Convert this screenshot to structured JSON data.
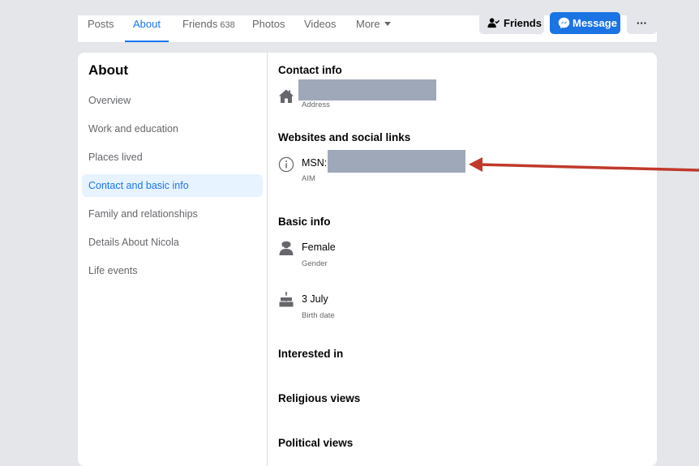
{
  "tabs": [
    {
      "label": "Posts"
    },
    {
      "label": "About"
    },
    {
      "label": "Friends",
      "count": "638"
    },
    {
      "label": "Photos"
    },
    {
      "label": "Videos"
    },
    {
      "label": "More"
    }
  ],
  "actions": {
    "friends_label": "Friends",
    "message_label": "Message",
    "more_label": "···"
  },
  "sidebar": {
    "title": "About",
    "items": [
      {
        "label": "Overview"
      },
      {
        "label": "Work and education"
      },
      {
        "label": "Places lived"
      },
      {
        "label": "Contact and basic info",
        "active": true
      },
      {
        "label": "Family and relationships"
      },
      {
        "label": "Details About Nicola"
      },
      {
        "label": "Life events"
      }
    ]
  },
  "content": {
    "contact_info": {
      "heading": "Contact info",
      "address_caption": "Address",
      "icon": "home-icon"
    },
    "websites": {
      "heading": "Websites and social links",
      "msn_label": "MSN:",
      "caption": "AIM",
      "icon": "info-icon"
    },
    "basic_info": {
      "heading": "Basic info",
      "gender_value": "Female",
      "gender_caption": "Gender",
      "gender_icon": "person-icon",
      "birth_value": "3 July",
      "birth_caption": "Birth date",
      "birth_icon": "cake-icon"
    },
    "interested_in": {
      "heading": "Interested in"
    },
    "religious_views": {
      "heading": "Religious views"
    },
    "political_views": {
      "heading": "Political views"
    }
  },
  "colors": {
    "accent": "#1877f2",
    "message_button": "#1b74e4",
    "redaction": "#9fa8b8",
    "annotation_arrow": "#c0392b",
    "background": "#e4e6ea"
  }
}
